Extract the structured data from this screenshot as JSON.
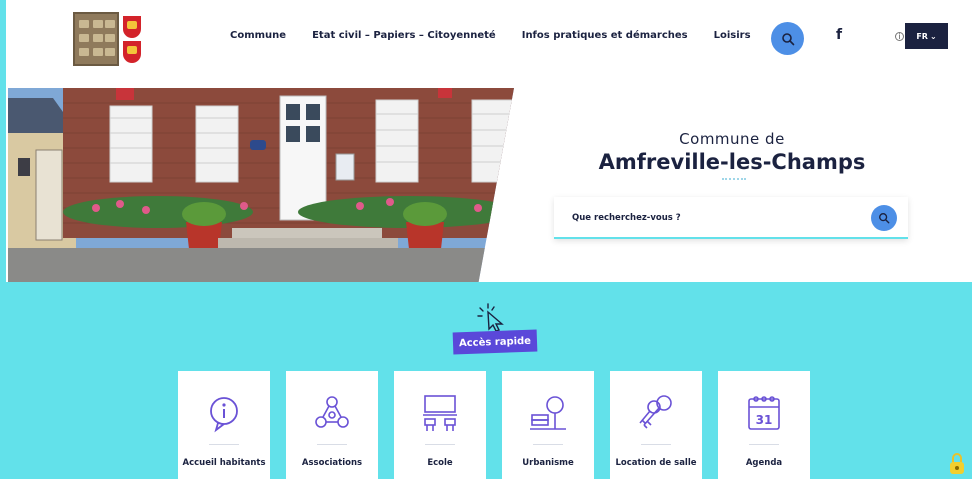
{
  "nav": {
    "items": [
      {
        "label": "Commune"
      },
      {
        "label": "Etat civil – Papiers – Citoyenneté"
      },
      {
        "label": "Infos pratiques et démarches"
      },
      {
        "label": "Loisirs"
      }
    ],
    "facebook_glyph": "f",
    "info_glyph": "i",
    "language": "FR",
    "language_caret": "⌄"
  },
  "icons": {
    "search": "search-icon",
    "facebook": "facebook-icon",
    "info": "info-icon",
    "cursor": "cursor-click-icon",
    "lock": "lock-icon"
  },
  "hero": {
    "subtitle": "Commune de",
    "title": "Amfreville-les-Champs",
    "search_placeholder": "Que recherchez-vous ?"
  },
  "quick_access": {
    "label": "Accès rapide",
    "tiles": [
      {
        "label": "Accueil habitants",
        "icon": "info-bubble-icon"
      },
      {
        "label": "Associations",
        "icon": "associations-icon"
      },
      {
        "label": "Ecole",
        "icon": "school-icon"
      },
      {
        "label": "Urbanisme",
        "icon": "urbanism-icon"
      },
      {
        "label": "Location de salle",
        "icon": "keys-icon"
      },
      {
        "label": "Agenda",
        "icon": "calendar-icon",
        "day": "31"
      }
    ]
  },
  "colors": {
    "primary_dark": "#1b2240",
    "accent_blue": "#4d8fe6",
    "band_cyan": "#62e1ea",
    "tag_purple": "#5a48d9",
    "icon_purple": "#6a52d6"
  }
}
